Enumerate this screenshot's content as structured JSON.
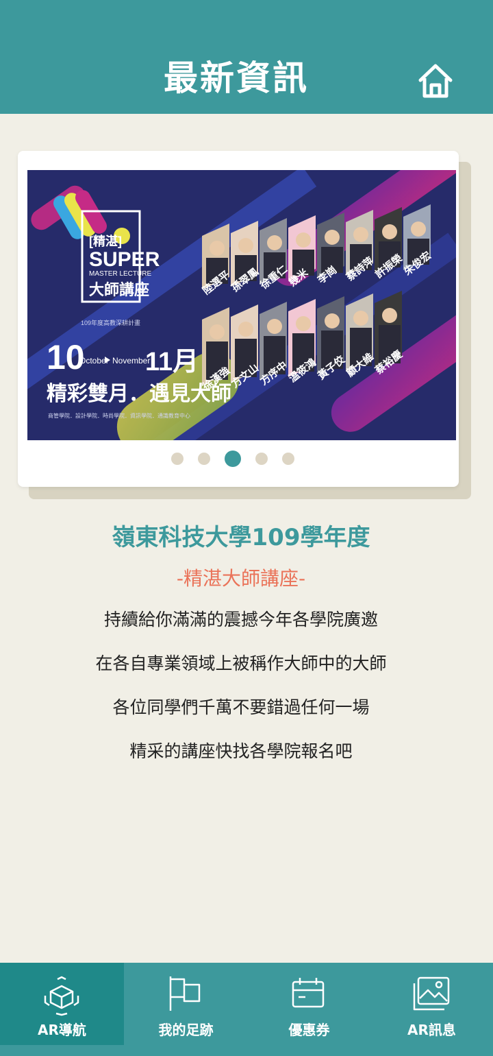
{
  "header": {
    "title": "最新資訊",
    "home_icon": "home-icon"
  },
  "banner": {
    "badge_line1": "[精湛]",
    "badge_line2": "SUPER",
    "badge_line3": "MASTER LECTURE",
    "badge_line4": "大師講座",
    "plan_line": "109年度高教深耕計畫",
    "month_start": "10",
    "month_start_en": "October",
    "month_end_en": "November",
    "month_end": "11月",
    "slogan": "精彩雙月．遇見大師",
    "colleges": "商管學院．設計學院．時尚學院．資訊學院．通識教育中心",
    "speakers_top": [
      "陸選平",
      "孫翠鳳",
      "徐重仁",
      "幾米",
      "李崗",
      "蔡詩萍",
      "許振榮",
      "朱俊宏"
    ],
    "speakers_bottom": [
      "徐漢強",
      "方文山",
      "方序中",
      "溫筱鴻",
      "黃子佼",
      "顧大維",
      "蔡裕慶"
    ]
  },
  "carousel": {
    "count": 5,
    "active_index": 2
  },
  "content": {
    "title": "嶺東科技大學109學年度",
    "subtitle": "-精湛大師講座-",
    "lines": [
      "持續給你滿滿的震撼今年各學院廣邀",
      "在各自專業領域上被稱作大師中的大師",
      "各位同學們千萬不要錯過任何一場",
      "精采的講座快找各學院報名吧"
    ]
  },
  "tabbar": {
    "items": [
      {
        "label": "AR導航",
        "icon": "ar-cube-icon",
        "active": true
      },
      {
        "label": "我的足跡",
        "icon": "flag-icon",
        "active": false
      },
      {
        "label": "優惠券",
        "icon": "calendar-icon",
        "active": false
      },
      {
        "label": "AR訊息",
        "icon": "image-icon",
        "active": false
      }
    ]
  },
  "colors": {
    "primary": "#3d999c",
    "primary_dark": "#1f8989",
    "accent": "#ea7359",
    "background": "#f1efe6"
  }
}
